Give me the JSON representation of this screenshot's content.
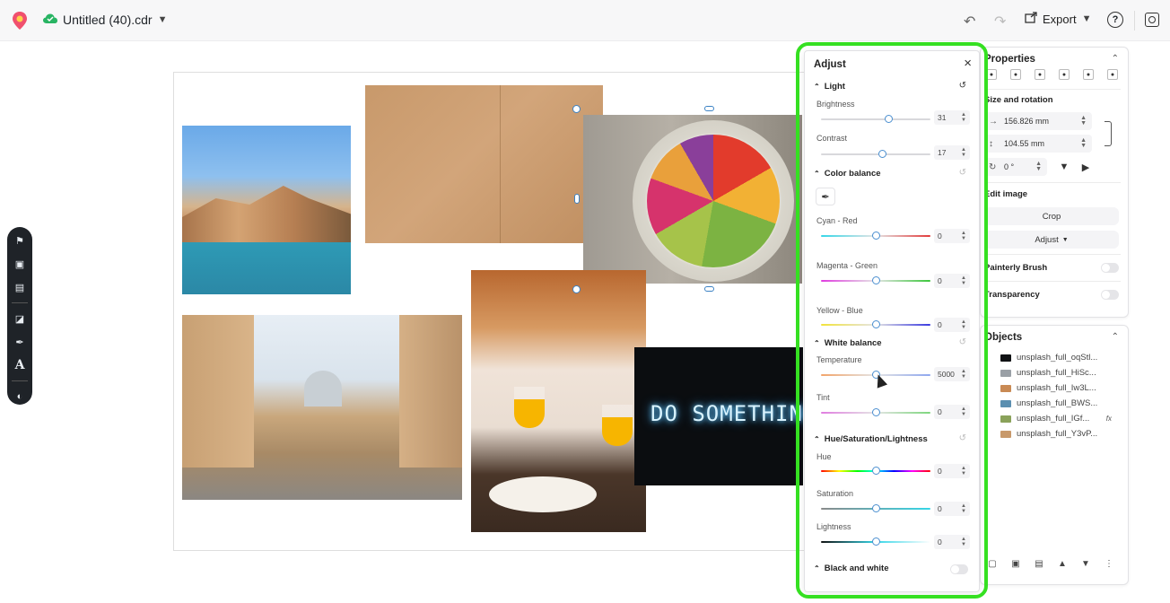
{
  "topbar": {
    "file_name": "Untitled (40).cdr",
    "export_label": "Export",
    "help_label": "?"
  },
  "canvas": {
    "neon_sign_text": "DO SOMETHING GR"
  },
  "left_toolbar": {
    "text_tool_label": "A"
  },
  "properties": {
    "title": "Properties",
    "size_rotation_label": "Size and rotation",
    "width_value": "156.826 mm",
    "height_value": "104.55 mm",
    "rotation_value": "0 °",
    "edit_image_label": "Edit image",
    "crop_label": "Crop",
    "adjust_label": "Adjust",
    "painterly_label": "Painterly Brush",
    "transparency_label": "Transparency"
  },
  "objects": {
    "title": "Objects",
    "items": [
      {
        "name": "unsplash_full_oqStl...",
        "thumb": "#101214",
        "fx": ""
      },
      {
        "name": "unsplash_full_HiSc...",
        "thumb": "#9aa0a6",
        "fx": ""
      },
      {
        "name": "unsplash_full_Iw3L...",
        "thumb": "#c98a54",
        "fx": ""
      },
      {
        "name": "unsplash_full_BWS...",
        "thumb": "#5b8fb0",
        "fx": ""
      },
      {
        "name": "unsplash_full_IGf...",
        "thumb": "#8aa25a",
        "fx": "fx"
      },
      {
        "name": "unsplash_full_Y3vP...",
        "thumb": "#c8996b",
        "fx": ""
      }
    ]
  },
  "adjust": {
    "title": "Adjust",
    "light_label": "Light",
    "brightness_label": "Brightness",
    "brightness_value": "31",
    "brightness_pos": 0.62,
    "contrast_label": "Contrast",
    "contrast_value": "17",
    "contrast_pos": 0.56,
    "color_balance_label": "Color balance",
    "cyan_red_label": "Cyan - Red",
    "cyan_red_value": "0",
    "magenta_green_label": "Magenta - Green",
    "magenta_green_value": "0",
    "yellow_blue_label": "Yellow - Blue",
    "yellow_blue_value": "0",
    "white_balance_label": "White balance",
    "temperature_label": "Temperature",
    "temperature_value": "5000",
    "tint_label": "Tint",
    "tint_value": "0",
    "hsl_label": "Hue/Saturation/Lightness",
    "hue_label": "Hue",
    "hue_value": "0",
    "saturation_label": "Saturation",
    "saturation_value": "0",
    "lightness_label": "Lightness",
    "lightness_value": "0",
    "bw_label": "Black and white"
  },
  "colors": {
    "highlight_outline": "#35e021",
    "handle_blue": "#3b82c4",
    "toolbar_bg": "#1f2328"
  }
}
